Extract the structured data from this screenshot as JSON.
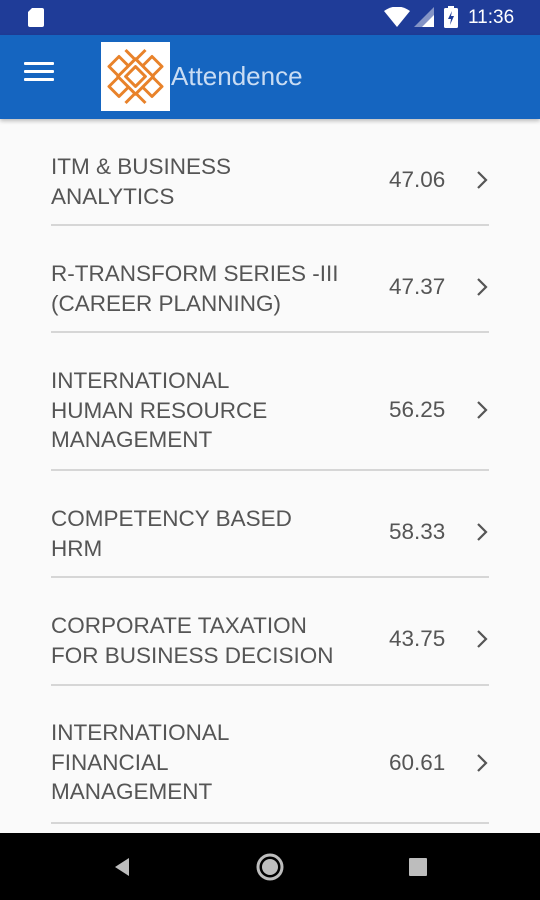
{
  "status_bar": {
    "time": "11:36"
  },
  "app_bar": {
    "title": "Attendence"
  },
  "subjects": [
    {
      "name": "ITM &  BUSINESS\nANALYTICS",
      "percentage": "47.06"
    },
    {
      "name": "R-TRANSFORM SERIES -III\n(CAREER PLANNING)",
      "percentage": "47.37"
    },
    {
      "name": "INTERNATIONAL\nHUMAN RESOURCE\nMANAGEMENT",
      "percentage": "56.25"
    },
    {
      "name": "COMPETENCY  BASED\nHRM",
      "percentage": "58.33"
    },
    {
      "name": "CORPORATE TAXATION\nFOR BUSINESS DECISION",
      "percentage": "43.75"
    },
    {
      "name": "INTERNATIONAL\nFINANCIAL\nMANAGEMENT",
      "percentage": "60.61"
    }
  ],
  "icons": {
    "menu": "menu-icon",
    "chevron": "chevron-right-icon",
    "back": "back-icon",
    "home": "home-icon",
    "recent": "recent-apps-icon"
  },
  "colors": {
    "status_bar": "#1f3c98",
    "app_bar": "#1565c0",
    "logo_orange": "#e8822a",
    "text": "#555555"
  }
}
